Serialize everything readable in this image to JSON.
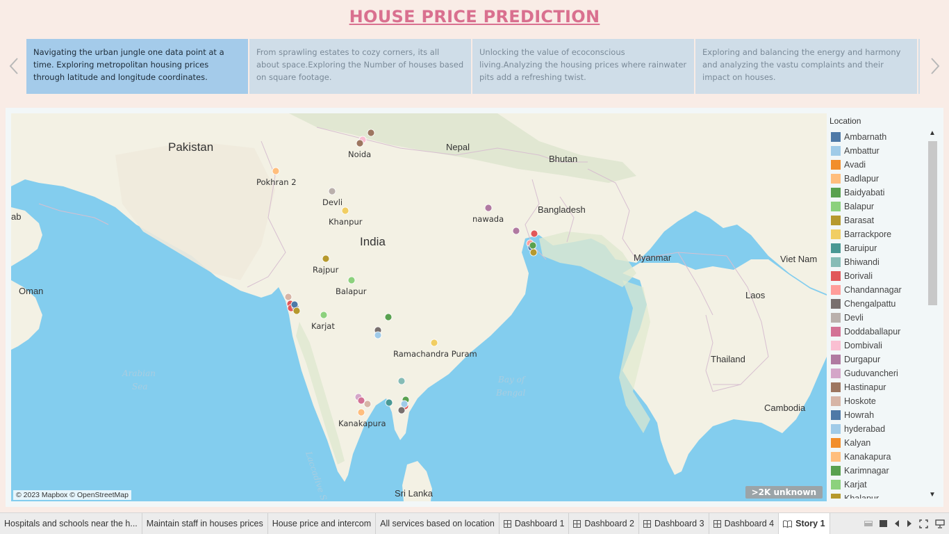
{
  "title": "HOUSE PRICE PREDICTION",
  "story_points": [
    {
      "text": "Navigating the urban jungle one data point at a time. Exploring metropolitan housing prices through latitude and longitude coordinates.",
      "active": true
    },
    {
      "text": "From sprawling estates to cozy corners, its all about space.Exploring the Number of houses based on square footage.",
      "active": false
    },
    {
      "text": "Unlocking the value of ecoconscious living.Analyzing the housing prices where rainwater pits add a refreshing twist.",
      "active": false
    },
    {
      "text": " Exploring and balancing the energy and harmony and analyzing the vastu complaints and their impact on houses.",
      "active": false
    }
  ],
  "map": {
    "attribution": "© 2023 Mapbox © OpenStreetMap",
    "unknown_badge": ">2K unknown",
    "country_labels": {
      "pakistan": "Pakistan",
      "nepal": "Nepal",
      "bhutan": "Bhutan",
      "bangladesh": "Bangladesh",
      "india": "India",
      "myanmar": "Myanmar",
      "vietnam": "Viet Nam",
      "laos": "Laos",
      "thailand": "Thailand",
      "cambodia": "Cambodia",
      "oman": "Oman",
      "srilanka": "Sri Lanka",
      "ab": "ab"
    },
    "sea_labels": {
      "arabian1": "Arabian",
      "arabian2": "Sea",
      "bay1": "Bay of",
      "bay2": "Bengal",
      "laccadive": "Laccadive S"
    },
    "city_labels": {
      "noida": "Noida",
      "pokhran": "Pokhran 2",
      "devli": "Devli",
      "khanpur": "Khanpur",
      "nawada": "nawada",
      "rajpur": "Rajpur",
      "balapur": "Balapur",
      "karjat": "Karjat",
      "ramachandra": "Ramachandra Puram",
      "kanakapura": "Kanakapura"
    }
  },
  "legend": {
    "title": "Location",
    "items": [
      {
        "label": "Ambarnath",
        "color": "#4e79a7"
      },
      {
        "label": "Ambattur",
        "color": "#a0cbe8"
      },
      {
        "label": "Avadi",
        "color": "#f28e2b"
      },
      {
        "label": "Badlapur",
        "color": "#ffbe7d"
      },
      {
        "label": "Baidyabati",
        "color": "#59a14f"
      },
      {
        "label": "Balapur",
        "color": "#8cd17d"
      },
      {
        "label": "Barasat",
        "color": "#b6992d"
      },
      {
        "label": "Barrackpore",
        "color": "#f1ce63"
      },
      {
        "label": "Baruipur",
        "color": "#499894"
      },
      {
        "label": "Bhiwandi",
        "color": "#86bcb6"
      },
      {
        "label": "Borivali",
        "color": "#e15759"
      },
      {
        "label": "Chandannagar",
        "color": "#ff9d9a"
      },
      {
        "label": "Chengalpattu",
        "color": "#79706e"
      },
      {
        "label": "Devli",
        "color": "#bab0ac"
      },
      {
        "label": "Doddaballapur",
        "color": "#d37295"
      },
      {
        "label": "Dombivali",
        "color": "#fabfd2"
      },
      {
        "label": "Durgapur",
        "color": "#b07aa1"
      },
      {
        "label": "Guduvancheri",
        "color": "#d4a6c8"
      },
      {
        "label": "Hastinapur",
        "color": "#9d7660"
      },
      {
        "label": "Hoskote",
        "color": "#d7b5a6"
      },
      {
        "label": "Howrah",
        "color": "#4e79a7"
      },
      {
        "label": "hyderabad",
        "color": "#a0cbe8"
      },
      {
        "label": "Kalyan",
        "color": "#f28e2b"
      },
      {
        "label": "Kanakapura",
        "color": "#ffbe7d"
      },
      {
        "label": "Karimnagar",
        "color": "#59a14f"
      },
      {
        "label": "Karjat",
        "color": "#8cd17d"
      },
      {
        "label": "Khalapur",
        "color": "#b6992d"
      }
    ]
  },
  "tabs": [
    {
      "label": "Hospitals and schools near the h...",
      "icon": "",
      "active": false
    },
    {
      "label": "Maintain staff in houses prices",
      "icon": "",
      "active": false
    },
    {
      "label": "House price and intercom",
      "icon": "",
      "active": false
    },
    {
      "label": "All services based on location",
      "icon": "",
      "active": false
    },
    {
      "label": "Dashboard 1",
      "icon": "dashboard-icon",
      "active": false
    },
    {
      "label": "Dashboard 2",
      "icon": "dashboard-icon",
      "active": false
    },
    {
      "label": "Dashboard 3",
      "icon": "dashboard-icon",
      "active": false
    },
    {
      "label": "Dashboard 4",
      "icon": "dashboard-icon",
      "active": false
    },
    {
      "label": "Story 1",
      "icon": "story-icon",
      "active": true
    }
  ]
}
